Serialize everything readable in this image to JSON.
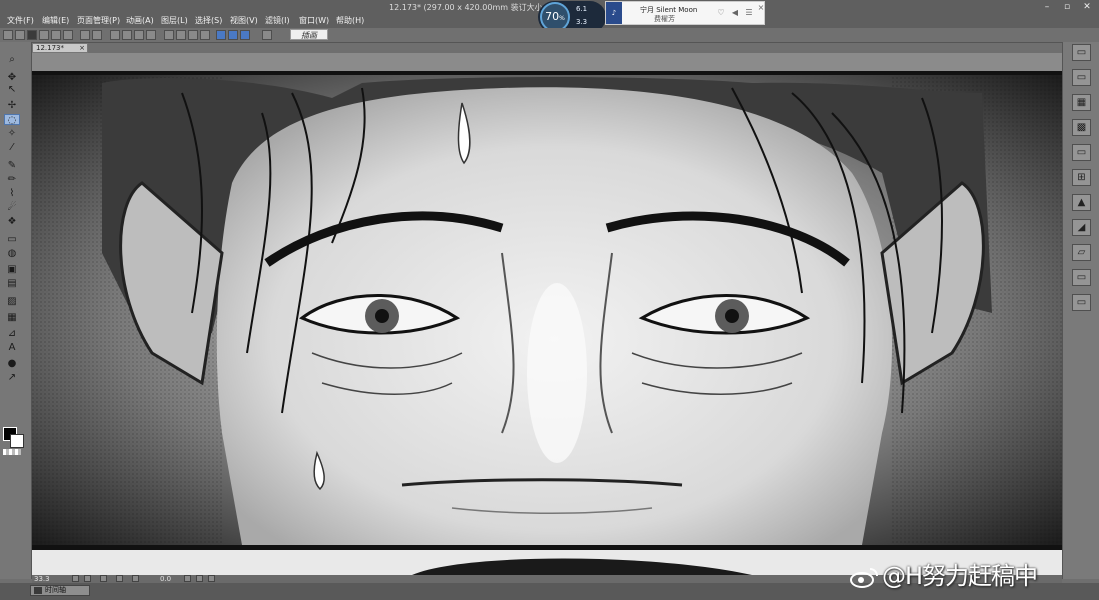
{
  "app": {
    "document_title": "12.173* (297.00 x 420.00mm 装订大小:B4 纸 25"
  },
  "menu": [
    {
      "label": "文件(F)"
    },
    {
      "label": "编辑(E)"
    },
    {
      "label": "页面管理(P)"
    },
    {
      "label": "动画(A)"
    },
    {
      "label": "图层(L)"
    },
    {
      "label": "选择(S)"
    },
    {
      "label": "视图(V)"
    },
    {
      "label": "滤镜(I)"
    },
    {
      "label": "窗口(W)"
    },
    {
      "label": "帮助(H)"
    }
  ],
  "monitor": {
    "percent": "70",
    "percent_unit": "%",
    "up": "6.1",
    "down": "3.3"
  },
  "player": {
    "song": "宁月 Silent Moon",
    "artist": "费櫂芳"
  },
  "toolbar": {
    "badge_text": "插画"
  },
  "document_tab": {
    "label": "12.173*"
  },
  "tools": [
    {
      "icon": "zoom-icon",
      "glyph": "⌕"
    },
    {
      "icon": "move-icon",
      "glyph": "✥"
    },
    {
      "icon": "operation-icon",
      "glyph": "↖"
    },
    {
      "icon": "move-layer-icon",
      "glyph": "✢"
    },
    {
      "icon": "selection-icon",
      "glyph": "◌"
    },
    {
      "icon": "auto-select-icon",
      "glyph": "✧"
    },
    {
      "icon": "eyedropper-icon",
      "glyph": "⁄"
    },
    {
      "icon": "pen-icon",
      "glyph": "✎"
    },
    {
      "icon": "pencil-icon",
      "glyph": "✏"
    },
    {
      "icon": "brush-icon",
      "glyph": "⌇"
    },
    {
      "icon": "airbrush-icon",
      "glyph": "☄"
    },
    {
      "icon": "decoration-icon",
      "glyph": "❖"
    },
    {
      "icon": "eraser-icon",
      "glyph": "▭"
    },
    {
      "icon": "blend-icon",
      "glyph": "◍"
    },
    {
      "icon": "fill-icon",
      "glyph": "▣"
    },
    {
      "icon": "gradient-icon",
      "glyph": "▤"
    },
    {
      "icon": "figure-icon",
      "glyph": "▨"
    },
    {
      "icon": "frame-border-icon",
      "glyph": "▦"
    },
    {
      "icon": "ruler-icon",
      "glyph": "⊿"
    },
    {
      "icon": "text-icon",
      "glyph": "A"
    },
    {
      "icon": "balloon-icon",
      "glyph": "●"
    },
    {
      "icon": "correct-line-icon",
      "glyph": "↗"
    }
  ],
  "palette_buttons": [
    {
      "icon": "folder-icon",
      "glyph": "▭"
    },
    {
      "icon": "folder-open-icon",
      "glyph": "▭"
    },
    {
      "icon": "pattern-icon",
      "glyph": "▦"
    },
    {
      "icon": "checker-icon",
      "glyph": "▩"
    },
    {
      "icon": "folder-icon",
      "glyph": "▭"
    },
    {
      "icon": "layer-set-icon",
      "glyph": "⊞"
    },
    {
      "icon": "image-icon",
      "glyph": "▲"
    },
    {
      "icon": "image-layer-icon",
      "glyph": "◢"
    },
    {
      "icon": "material-icon",
      "glyph": "▱"
    },
    {
      "icon": "palette-icon",
      "glyph": "▭"
    },
    {
      "icon": "folder-icon",
      "glyph": "▭"
    }
  ],
  "status": {
    "zoom": "33.3",
    "angle": "0.0"
  },
  "bottom_tab": {
    "label": "时间轴"
  },
  "watermark": {
    "text": "@H努力赶稿中"
  },
  "colors": {
    "ui_gray": "#6f6f6f",
    "accent_blue": "#4a79c4",
    "canvas": "#f4f4f4"
  }
}
